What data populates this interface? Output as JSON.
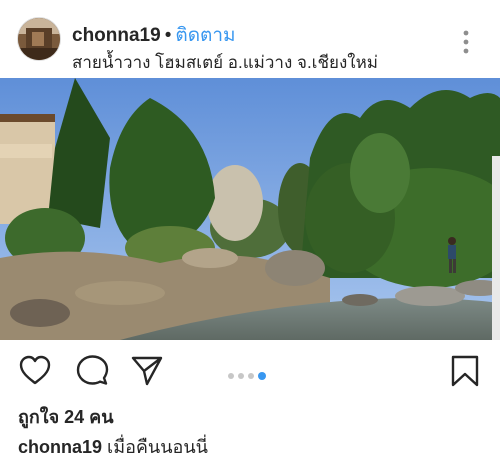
{
  "post": {
    "username": "chonna19",
    "separator": "•",
    "follow_label": "ติดตาม",
    "location": "สายน้ำวาง โฮมสเตย์ อ.แม่วาง จ.เชียงใหม่",
    "likes_label": "ถูกใจ 24 คน",
    "caption_username": "chonna19",
    "caption_text": "เมื่อคืนนอนนี่"
  },
  "carousel": {
    "total": 4,
    "active_index": 3
  },
  "icons": [
    "more-options-icon",
    "heart-icon",
    "comment-icon",
    "share-icon",
    "bookmark-icon"
  ],
  "colors": {
    "accent": "#3897f0",
    "text": "#262626",
    "inactive_dot": "#c7c7c7"
  }
}
